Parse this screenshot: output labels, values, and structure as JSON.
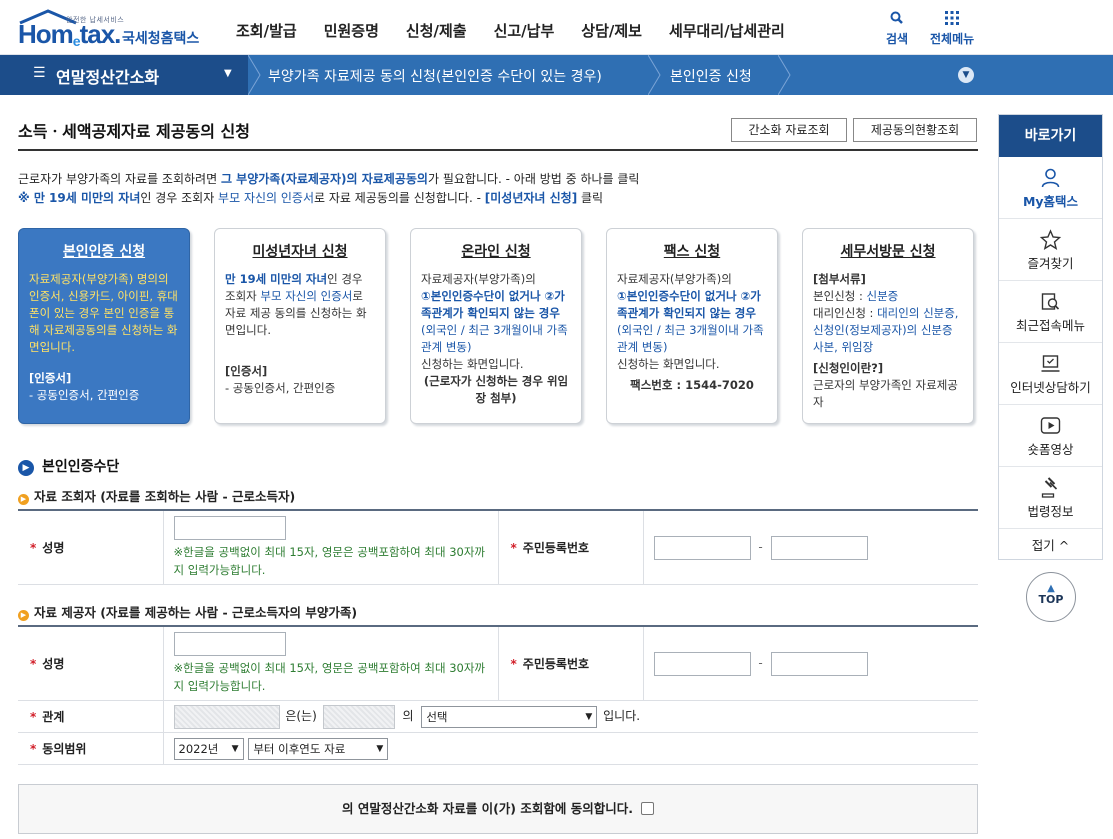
{
  "header": {
    "logo_small": "안전한 납세서비스",
    "logo_brand_1": "Hom",
    "logo_brand_e": "e",
    "logo_brand_2": "tax.",
    "logo_kr": "국세청홈택스",
    "nav": [
      "조회/발급",
      "민원증명",
      "신청/제출",
      "신고/납부",
      "상담/제보",
      "세무대리/납세관리"
    ],
    "search_label": "검색",
    "allmenu_label": "전체메뉴"
  },
  "breadcrumb": {
    "current": "연말정산간소화",
    "items": [
      "부양가족 자료제공 동의 신청(본인인증 수단이 있는 경우)",
      "본인인증 신청"
    ]
  },
  "page": {
    "title": "소득ㆍ세액공제자료 제공동의 신청",
    "btn_lookup": "간소화 자료조회",
    "btn_status": "제공동의현황조회",
    "intro1_a": "근로자가 부양가족의 자료를 조회하려면 ",
    "intro1_b": "그 부양가족(자료제공자)의 자료제공동의",
    "intro1_c": "가 필요합니다. - 아래 방법 중 하나를 클릭",
    "intro2_a": "※ 만 19세 미만의 자녀",
    "intro2_b": "인 경우 조회자 ",
    "intro2_c": "부모 자신의 인증서",
    "intro2_d": "로 자료 제공동의를 신청합니다. - ",
    "intro2_e": "[미성년자녀 신청]",
    "intro2_f": " 클릭"
  },
  "cards": {
    "c1": {
      "title": "본인인증 신청",
      "body": "자료제공자(부양가족) 명의의 인증서, 신용카드, 아이핀, 휴대폰이 있는 경우 본인 인증을 통해 자료제공동의를 신청하는 화면입니다.",
      "cert_title": "[인증서]",
      "cert_body": "- 공동인증서, 간편인증"
    },
    "c2": {
      "title": "미성년자녀 신청",
      "b1": "만 19세 미만의 자녀",
      "b2": "인 경우 조회자 ",
      "b3": "부모 자신의 인증서",
      "b4": "로 자료 제공 동의를 신청하는 화면입니다.",
      "cert_title": "[인증서]",
      "cert_body": "- 공동인증서, 간편인증"
    },
    "c3": {
      "title": "온라인 신청",
      "b1": "자료제공자(부양가족)의",
      "b2": "①본인인증수단이 없거나 ②가족관계가 확인되지 않는 경우",
      "b3": "(외국인 / 최근 3개월이내 가족관계 변동)",
      "b4": "신청하는 화면입니다.",
      "b5": "(근로자가 신청하는 경우 위임장 첨부)"
    },
    "c4": {
      "title": "팩스 신청",
      "b1": "자료제공자(부양가족)의",
      "b2": "①본인인증수단이 없거나 ②가족관계가 확인되지 않는 경우",
      "b3": "(외국인 / 최근 3개월이내 가족관계 변동)",
      "b4": "신청하는 화면입니다.",
      "b5": "팩스번호 : 1544-7020"
    },
    "c5": {
      "title": "세무서방문 신청",
      "b1": "[첨부서류]",
      "b2": "본인신청 : ",
      "b3": "신분증",
      "b4": "대리인신청 : ",
      "b5": "대리인의 신분증, 신청인(정보제공자)의 신분증 사본, 위임장",
      "b6": "[신청인이란?]",
      "b7": "근로자의 부양가족인 자료제공자"
    }
  },
  "form": {
    "section": "본인인증수단",
    "sub1": "자료 조회자 (자료를 조회하는 사람 - 근로소득자)",
    "sub2": "자료 제공자 (자료를 제공하는 사람 - 근로소득자의 부양가족)",
    "req": "*",
    "name_label": "성명",
    "rrn_label": "주민등록번호",
    "name_hint": "※한글을 공백없이 최대 15자, 영문은 공백포함하여 최대 30자까지 입력가능합니다.",
    "dash": "-",
    "rel_label": "관계",
    "rel_text1": "은(는)",
    "rel_text2": "의",
    "rel_select": "선택",
    "rel_text3": "입니다.",
    "scope_label": "동의범위",
    "year_select": "2022년",
    "scope_select": "부터 이후연도 자료",
    "agree_text": "의 연말정산간소화 자료를 이(가) 조회함에 동의합니다."
  },
  "quick": {
    "title": "바로가기",
    "items": [
      "My홈택스",
      "즐겨찾기",
      "최근접속메뉴",
      "인터넷상담하기",
      "숏폼영상",
      "법령정보"
    ],
    "fold": "접기",
    "top": "TOP"
  },
  "colors": {
    "brand": "#1a56a8",
    "navbar": "#2f6fb3",
    "navbar_dark": "#1c4d8a",
    "active_card": "#3b78c2",
    "required": "#d2202a",
    "hint": "#2e7d32"
  }
}
